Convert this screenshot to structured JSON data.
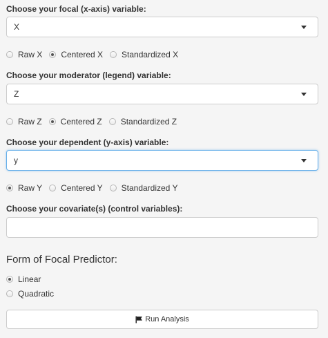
{
  "focal": {
    "label": "Choose your focal (x-axis) variable:",
    "selected": "X",
    "options": [
      "Raw X",
      "Centered X",
      "Standardized X"
    ],
    "checked_index": 1
  },
  "moderator": {
    "label": "Choose your moderator (legend) variable:",
    "selected": "Z",
    "options": [
      "Raw Z",
      "Centered Z",
      "Standardized Z"
    ],
    "checked_index": 1
  },
  "dependent": {
    "label": "Choose your dependent (y-axis) variable:",
    "selected": "y",
    "options": [
      "Raw Y",
      "Centered Y",
      "Standardized Y"
    ],
    "checked_index": 0
  },
  "covariates": {
    "label": "Choose your covariate(s) (control variables):",
    "value": ""
  },
  "focal_form": {
    "heading": "Form of Focal Predictor:",
    "options": [
      "Linear",
      "Quadratic"
    ],
    "checked_index": 0
  },
  "run_button": {
    "label": "Run Analysis",
    "icon": "flag-icon"
  }
}
